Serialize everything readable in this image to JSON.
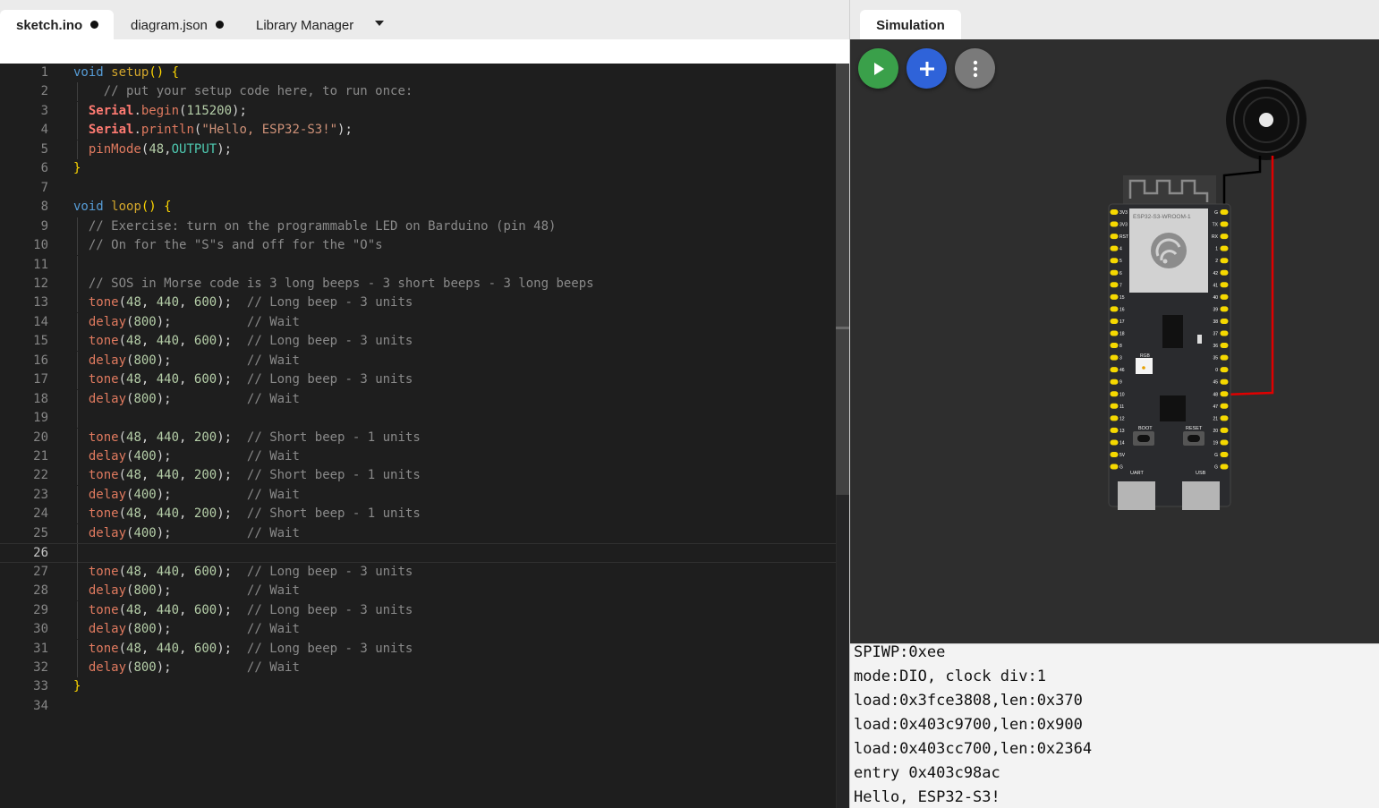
{
  "editor": {
    "tabs": [
      {
        "label": "sketch.ino",
        "modified": true,
        "active": true
      },
      {
        "label": "diagram.json",
        "modified": true,
        "active": false
      },
      {
        "label": "Library Manager",
        "modified": false,
        "active": false
      }
    ],
    "current_line": 26,
    "lines": [
      [
        [
          "k",
          "void"
        ],
        [
          "p",
          " "
        ],
        [
          "fy",
          "setup"
        ],
        [
          "br",
          "()"
        ],
        [
          "p",
          " "
        ],
        [
          "br",
          "{"
        ]
      ],
      [
        [
          "p",
          "    "
        ],
        [
          "cm",
          "// put your setup code here, to run once:"
        ]
      ],
      [
        [
          "p",
          "  "
        ],
        [
          "cl",
          "Serial"
        ],
        [
          "p",
          "."
        ],
        [
          "m",
          "begin"
        ],
        [
          "p",
          "("
        ],
        [
          "num",
          "115200"
        ],
        [
          "p",
          ");"
        ]
      ],
      [
        [
          "p",
          "  "
        ],
        [
          "cl",
          "Serial"
        ],
        [
          "p",
          "."
        ],
        [
          "m",
          "println"
        ],
        [
          "p",
          "("
        ],
        [
          "str",
          "\"Hello, ESP32-S3!\""
        ],
        [
          "p",
          ");"
        ]
      ],
      [
        [
          "p",
          "  "
        ],
        [
          "m",
          "pinMode"
        ],
        [
          "p",
          "("
        ],
        [
          "num",
          "48"
        ],
        [
          "p",
          ","
        ],
        [
          "cst",
          "OUTPUT"
        ],
        [
          "p",
          ");"
        ]
      ],
      [
        [
          "br",
          "}"
        ]
      ],
      [],
      [
        [
          "k",
          "void"
        ],
        [
          "p",
          " "
        ],
        [
          "fy",
          "loop"
        ],
        [
          "br",
          "()"
        ],
        [
          "p",
          " "
        ],
        [
          "br",
          "{"
        ]
      ],
      [
        [
          "p",
          "  "
        ],
        [
          "cm",
          "// Exercise: turn on the programmable LED on Barduino (pin 48)"
        ]
      ],
      [
        [
          "p",
          "  "
        ],
        [
          "cm",
          "// On for the \"S\"s and off for the \"O\"s"
        ]
      ],
      [],
      [
        [
          "p",
          "  "
        ],
        [
          "cm",
          "// SOS in Morse code is 3 long beeps - 3 short beeps - 3 long beeps"
        ]
      ],
      [
        [
          "p",
          "  "
        ],
        [
          "m",
          "tone"
        ],
        [
          "p",
          "("
        ],
        [
          "num",
          "48"
        ],
        [
          "p",
          ", "
        ],
        [
          "num",
          "440"
        ],
        [
          "p",
          ", "
        ],
        [
          "num",
          "600"
        ],
        [
          "p",
          ");  "
        ],
        [
          "cm",
          "// Long beep - 3 units"
        ]
      ],
      [
        [
          "p",
          "  "
        ],
        [
          "m",
          "delay"
        ],
        [
          "p",
          "("
        ],
        [
          "num",
          "800"
        ],
        [
          "p",
          ");          "
        ],
        [
          "cm",
          "// Wait"
        ]
      ],
      [
        [
          "p",
          "  "
        ],
        [
          "m",
          "tone"
        ],
        [
          "p",
          "("
        ],
        [
          "num",
          "48"
        ],
        [
          "p",
          ", "
        ],
        [
          "num",
          "440"
        ],
        [
          "p",
          ", "
        ],
        [
          "num",
          "600"
        ],
        [
          "p",
          ");  "
        ],
        [
          "cm",
          "// Long beep - 3 units"
        ]
      ],
      [
        [
          "p",
          "  "
        ],
        [
          "m",
          "delay"
        ],
        [
          "p",
          "("
        ],
        [
          "num",
          "800"
        ],
        [
          "p",
          ");          "
        ],
        [
          "cm",
          "// Wait"
        ]
      ],
      [
        [
          "p",
          "  "
        ],
        [
          "m",
          "tone"
        ],
        [
          "p",
          "("
        ],
        [
          "num",
          "48"
        ],
        [
          "p",
          ", "
        ],
        [
          "num",
          "440"
        ],
        [
          "p",
          ", "
        ],
        [
          "num",
          "600"
        ],
        [
          "p",
          ");  "
        ],
        [
          "cm",
          "// Long beep - 3 units"
        ]
      ],
      [
        [
          "p",
          "  "
        ],
        [
          "m",
          "delay"
        ],
        [
          "p",
          "("
        ],
        [
          "num",
          "800"
        ],
        [
          "p",
          ");          "
        ],
        [
          "cm",
          "// Wait"
        ]
      ],
      [],
      [
        [
          "p",
          "  "
        ],
        [
          "m",
          "tone"
        ],
        [
          "p",
          "("
        ],
        [
          "num",
          "48"
        ],
        [
          "p",
          ", "
        ],
        [
          "num",
          "440"
        ],
        [
          "p",
          ", "
        ],
        [
          "num",
          "200"
        ],
        [
          "p",
          ");  "
        ],
        [
          "cm",
          "// Short beep - 1 units"
        ]
      ],
      [
        [
          "p",
          "  "
        ],
        [
          "m",
          "delay"
        ],
        [
          "p",
          "("
        ],
        [
          "num",
          "400"
        ],
        [
          "p",
          ");          "
        ],
        [
          "cm",
          "// Wait"
        ]
      ],
      [
        [
          "p",
          "  "
        ],
        [
          "m",
          "tone"
        ],
        [
          "p",
          "("
        ],
        [
          "num",
          "48"
        ],
        [
          "p",
          ", "
        ],
        [
          "num",
          "440"
        ],
        [
          "p",
          ", "
        ],
        [
          "num",
          "200"
        ],
        [
          "p",
          ");  "
        ],
        [
          "cm",
          "// Short beep - 1 units"
        ]
      ],
      [
        [
          "p",
          "  "
        ],
        [
          "m",
          "delay"
        ],
        [
          "p",
          "("
        ],
        [
          "num",
          "400"
        ],
        [
          "p",
          ");          "
        ],
        [
          "cm",
          "// Wait"
        ]
      ],
      [
        [
          "p",
          "  "
        ],
        [
          "m",
          "tone"
        ],
        [
          "p",
          "("
        ],
        [
          "num",
          "48"
        ],
        [
          "p",
          ", "
        ],
        [
          "num",
          "440"
        ],
        [
          "p",
          ", "
        ],
        [
          "num",
          "200"
        ],
        [
          "p",
          ");  "
        ],
        [
          "cm",
          "// Short beep - 1 units"
        ]
      ],
      [
        [
          "p",
          "  "
        ],
        [
          "m",
          "delay"
        ],
        [
          "p",
          "("
        ],
        [
          "num",
          "400"
        ],
        [
          "p",
          ");          "
        ],
        [
          "cm",
          "// Wait"
        ]
      ],
      [],
      [
        [
          "p",
          "  "
        ],
        [
          "m",
          "tone"
        ],
        [
          "p",
          "("
        ],
        [
          "num",
          "48"
        ],
        [
          "p",
          ", "
        ],
        [
          "num",
          "440"
        ],
        [
          "p",
          ", "
        ],
        [
          "num",
          "600"
        ],
        [
          "p",
          ");  "
        ],
        [
          "cm",
          "// Long beep - 3 units"
        ]
      ],
      [
        [
          "p",
          "  "
        ],
        [
          "m",
          "delay"
        ],
        [
          "p",
          "("
        ],
        [
          "num",
          "800"
        ],
        [
          "p",
          ");          "
        ],
        [
          "cm",
          "// Wait"
        ]
      ],
      [
        [
          "p",
          "  "
        ],
        [
          "m",
          "tone"
        ],
        [
          "p",
          "("
        ],
        [
          "num",
          "48"
        ],
        [
          "p",
          ", "
        ],
        [
          "num",
          "440"
        ],
        [
          "p",
          ", "
        ],
        [
          "num",
          "600"
        ],
        [
          "p",
          ");  "
        ],
        [
          "cm",
          "// Long beep - 3 units"
        ]
      ],
      [
        [
          "p",
          "  "
        ],
        [
          "m",
          "delay"
        ],
        [
          "p",
          "("
        ],
        [
          "num",
          "800"
        ],
        [
          "p",
          ");          "
        ],
        [
          "cm",
          "// Wait"
        ]
      ],
      [
        [
          "p",
          "  "
        ],
        [
          "m",
          "tone"
        ],
        [
          "p",
          "("
        ],
        [
          "num",
          "48"
        ],
        [
          "p",
          ", "
        ],
        [
          "num",
          "440"
        ],
        [
          "p",
          ", "
        ],
        [
          "num",
          "600"
        ],
        [
          "p",
          ");  "
        ],
        [
          "cm",
          "// Long beep - 3 units"
        ]
      ],
      [
        [
          "p",
          "  "
        ],
        [
          "m",
          "delay"
        ],
        [
          "p",
          "("
        ],
        [
          "num",
          "800"
        ],
        [
          "p",
          ");          "
        ],
        [
          "cm",
          "// Wait"
        ]
      ],
      [
        [
          "br",
          "}"
        ]
      ],
      []
    ]
  },
  "simulation": {
    "tab_label": "Simulation",
    "buttons": [
      {
        "name": "play",
        "icon": "play-icon",
        "color": "#3aa04a"
      },
      {
        "name": "add",
        "icon": "plus-icon",
        "color": "#2f63d9"
      },
      {
        "name": "more",
        "icon": "more-vertical-icon",
        "color": "#7a7a7a"
      }
    ],
    "board": {
      "module_label": "ESP32-S3-WROOM-1",
      "left_pins": [
        "3V3",
        "3V3",
        "RST",
        "4",
        "5",
        "6",
        "7",
        "15",
        "16",
        "17",
        "18",
        "8",
        "3",
        "46",
        "9",
        "10",
        "11",
        "12",
        "13",
        "14",
        "5V",
        "G"
      ],
      "right_pins": [
        "G",
        "TX",
        "RX",
        "1",
        "2",
        "42",
        "41",
        "40",
        "39",
        "38",
        "37",
        "36",
        "35",
        "0",
        "45",
        "48",
        "47",
        "21",
        "20",
        "19",
        "G",
        "G"
      ],
      "rgb_label": "RGB",
      "boot_label": "BOOT",
      "reset_label": "RESET",
      "uart_label": "UART",
      "usb_label": "USB",
      "wire_pin": "48",
      "wire_color": "#e00000"
    },
    "serial_output": [
      "SPIWP:0xee",
      "mode:DIO, clock div:1",
      "load:0x3fce3808,len:0x370",
      "load:0x403c9700,len:0x900",
      "load:0x403cc700,len:0x2364",
      "entry 0x403c98ac",
      "Hello, ESP32-S3!"
    ]
  }
}
